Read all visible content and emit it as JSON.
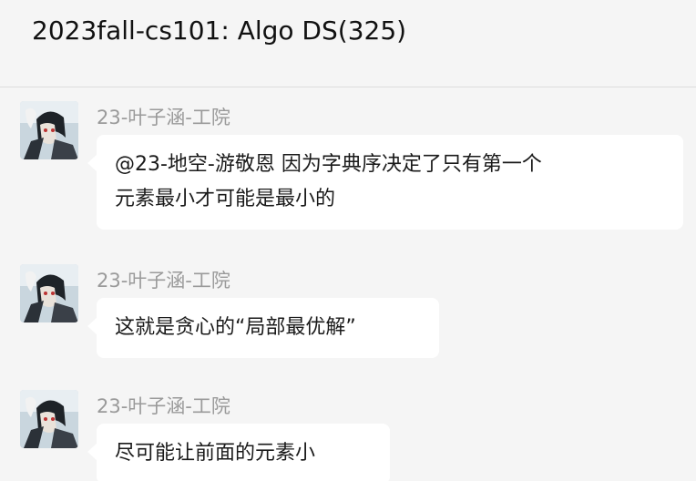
{
  "chat": {
    "title": "2023fall-cs101: Algo DS(325)"
  },
  "messages": [
    {
      "sender": "23-叶子涵-工院",
      "lines": [
        "@23-地空-游敬恩 因为字典序决定了只有第一个",
        "元素最小才可能是最小的"
      ]
    },
    {
      "sender": "23-叶子涵-工院",
      "lines": [
        "这就是贪心的“局部最优解”"
      ]
    },
    {
      "sender": "23-叶子涵-工院",
      "lines": [
        "尽可能让前面的元素小"
      ]
    }
  ],
  "colors": {
    "background": "#f5f5f5",
    "bubble": "#ffffff",
    "sender": "#9a9a9a",
    "divider": "#dcdcdc"
  },
  "icons": {
    "avatar": "user-avatar-anime"
  }
}
